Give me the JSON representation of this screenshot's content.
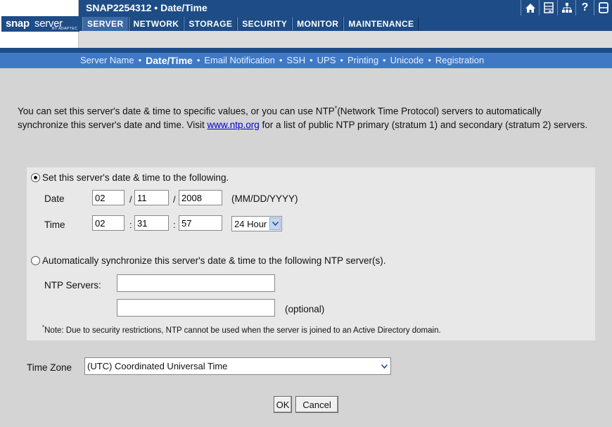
{
  "app": {
    "logo_snap": "snap",
    "logo_server": "server",
    "logo_sub": "BY ADAPTEC",
    "title": "SNAP2254312 • Date/Time"
  },
  "top_icons": [
    {
      "name": "home-icon"
    },
    {
      "name": "drives-icon"
    },
    {
      "name": "network-icon"
    },
    {
      "name": "help-icon",
      "glyph": "?"
    },
    {
      "name": "status-icon"
    }
  ],
  "tabs": [
    {
      "label": "SERVER",
      "active": true
    },
    {
      "label": "NETWORK",
      "active": false
    },
    {
      "label": "STORAGE",
      "active": false
    },
    {
      "label": "SECURITY",
      "active": false
    },
    {
      "label": "MONITOR",
      "active": false
    },
    {
      "label": "MAINTENANCE",
      "active": false
    }
  ],
  "subnav": [
    {
      "label": "Server Name",
      "active": false
    },
    {
      "label": "Date/Time",
      "active": true
    },
    {
      "label": "Email Notification",
      "active": false
    },
    {
      "label": "SSH",
      "active": false
    },
    {
      "label": "UPS",
      "active": false
    },
    {
      "label": "Printing",
      "active": false
    },
    {
      "label": "Unicode",
      "active": false
    },
    {
      "label": "Registration",
      "active": false
    }
  ],
  "intro": {
    "part1": "You can set this server's date & time to specific values, or you can use NTP",
    "sup": "*",
    "part2": "(Network Time Protocol) servers to automatically synchronize this server's date and time. Visit ",
    "link": "www.ntp.org",
    "part3": " for a list of public NTP primary (stratum 1) and secondary (stratum 2) servers."
  },
  "manual": {
    "radio_label": "Set this server's date & time to the following.",
    "selected": true,
    "date_label": "Date",
    "date_month": "02",
    "date_day": "11",
    "date_year": "2008",
    "date_sep": "/",
    "date_format": "(MM/DD/YYYY)",
    "time_label": "Time",
    "time_hour": "02",
    "time_minute": "31",
    "time_second": "57",
    "time_sep": ":",
    "hour_mode": "24 Hour"
  },
  "ntp": {
    "radio_label": "Automatically synchronize this server's date & time to the following NTP server(s).",
    "selected": false,
    "servers_label": "NTP Servers:",
    "server1": "",
    "server2": "",
    "optional": "(optional)",
    "note_sup": "*",
    "note": "Note: Due to security restrictions, NTP cannot be used when the server is joined to an Active Directory domain."
  },
  "timezone": {
    "label": "Time Zone",
    "value": "(UTC) Coordinated Universal Time"
  },
  "buttons": {
    "ok": "OK",
    "cancel": "Cancel"
  },
  "colors": {
    "header_blue": "#1e4c86",
    "subnav_blue": "#3f79c6",
    "background": "#d4d4d4",
    "panel": "#e8e8e8"
  }
}
